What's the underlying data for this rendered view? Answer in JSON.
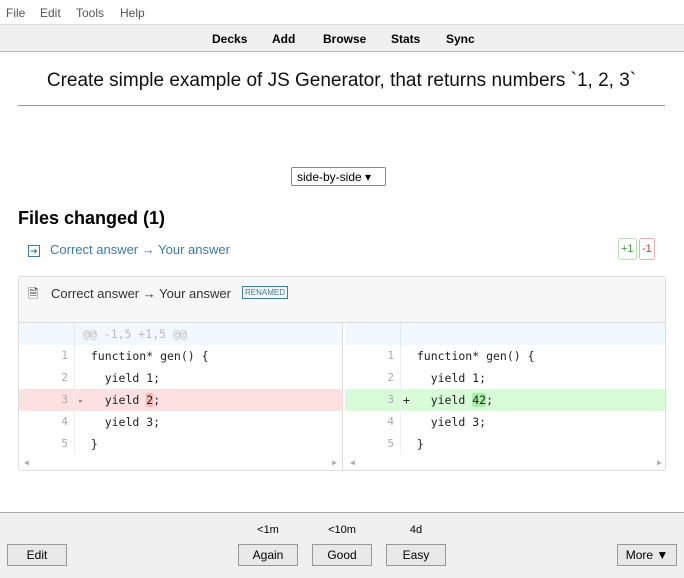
{
  "menu": [
    "File",
    "Edit",
    "Tools",
    "Help"
  ],
  "toolbar": [
    "Decks",
    "Add",
    "Browse",
    "Stats",
    "Sync"
  ],
  "question": "Create simple example of JS Generator, that returns numbers `1, 2, 3`",
  "view_select": "side-by-side ▾",
  "files_changed": "Files changed (1)",
  "file_link": "Correct answer → Your answer",
  "added": "+1",
  "removed": "-1",
  "file_header": "Correct answer → Your answer",
  "renamed_tag": "RENAMED",
  "hunk": "@@ -1,5 +1,5 @@",
  "left": [
    {
      "n": "1",
      "pre": "  function* gen() {",
      "hl": "",
      "post": ""
    },
    {
      "n": "2",
      "pre": "    yield 1;",
      "hl": "",
      "post": ""
    },
    {
      "n": "3",
      "pre": "-   yield ",
      "hl": "2",
      "post": ";"
    },
    {
      "n": "4",
      "pre": "    yield 3;",
      "hl": "",
      "post": ""
    },
    {
      "n": "5",
      "pre": "  }",
      "hl": "",
      "post": ""
    }
  ],
  "right": [
    {
      "n": "1",
      "pre": "  function* gen() {",
      "hl": "",
      "post": ""
    },
    {
      "n": "2",
      "pre": "    yield 1;",
      "hl": "",
      "post": ""
    },
    {
      "n": "3",
      "pre": "+   yield ",
      "hl": "42",
      "post": ";"
    },
    {
      "n": "4",
      "pre": "    yield 3;",
      "hl": "",
      "post": ""
    },
    {
      "n": "5",
      "pre": "  }",
      "hl": "",
      "post": ""
    }
  ],
  "bottom": {
    "edit": "Edit",
    "again": "Again",
    "good": "Good",
    "easy": "Easy",
    "more": "More ▼",
    "again_due": "<1m",
    "good_due": "<10m",
    "easy_due": "4d"
  }
}
